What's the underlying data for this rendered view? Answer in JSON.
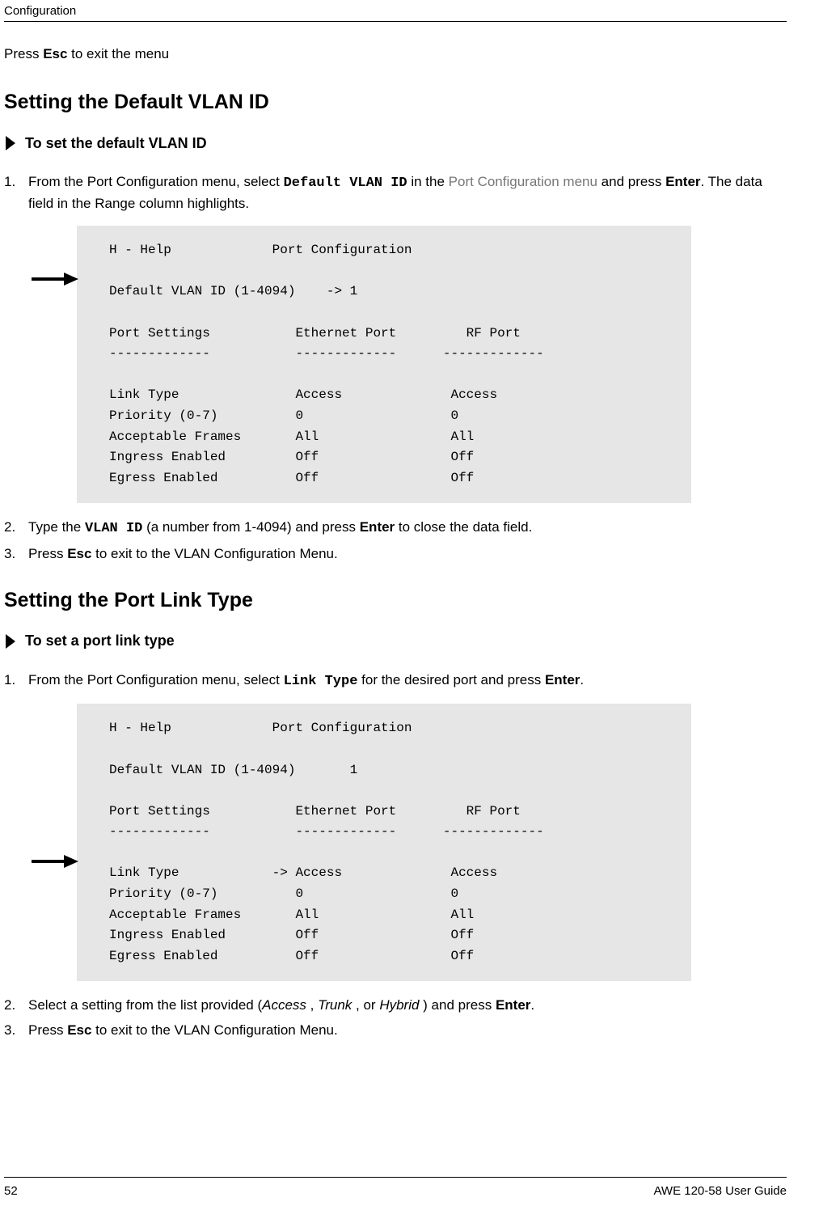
{
  "header": {
    "section": "Configuration"
  },
  "intro": {
    "prefix": "Press ",
    "key": "Esc",
    "suffix": " to exit the menu"
  },
  "section1": {
    "title": "Setting the Default VLAN ID",
    "proc_title": "To set the default VLAN ID",
    "step1": {
      "a": "From the Port Configuration menu, select ",
      "code": "Default VLAN ID",
      "b": " in the ",
      "light": "Port Configuration menu",
      "c": " and press ",
      "key": "Enter",
      "d": ". The data field in the Range column highlights."
    },
    "code": "H - Help             Port Configuration\n\nDefault VLAN ID (1-4094)    -> 1\n\nPort Settings           Ethernet Port         RF Port\n-------------           -------------      -------------\n\nLink Type               Access              Access\nPriority (0-7)          0                   0\nAcceptable Frames       All                 All\nIngress Enabled         Off                 Off\nEgress Enabled          Off                 Off",
    "step2": {
      "a": "Type the ",
      "code": "VLAN ID",
      "b": " (a number from 1-4094) and press ",
      "key": "Enter",
      "c": " to close the data field."
    },
    "step3": {
      "a": "Press ",
      "key": "Esc",
      "b": " to exit to the VLAN Configuration Menu."
    }
  },
  "section2": {
    "title": "Setting the Port Link Type",
    "proc_title": "To set a port link type",
    "step1": {
      "a": "From the Port Configuration menu, select ",
      "code": "Link Type",
      "b": " for the desired port and press ",
      "key": "Enter",
      "c": "."
    },
    "code": "H - Help             Port Configuration\n\nDefault VLAN ID (1-4094)       1\n\nPort Settings           Ethernet Port         RF Port\n-------------           -------------      -------------\n\nLink Type            -> Access              Access\nPriority (0-7)          0                   0\nAcceptable Frames       All                 All\nIngress Enabled         Off                 Off\nEgress Enabled          Off                 Off",
    "step2": {
      "a": "Select a setting from the list provided (",
      "opt1": "Access",
      "sep1": " , ",
      "opt2": "Trunk",
      "sep2": " , or ",
      "opt3": "Hybrid",
      "b": " ) and press ",
      "key": "Enter",
      "c": "."
    },
    "step3": {
      "a": "Press ",
      "key": "Esc",
      "b": " to exit to the VLAN Configuration Menu."
    }
  },
  "footer": {
    "page": "52",
    "guide": "AWE 120-58 User Guide"
  }
}
